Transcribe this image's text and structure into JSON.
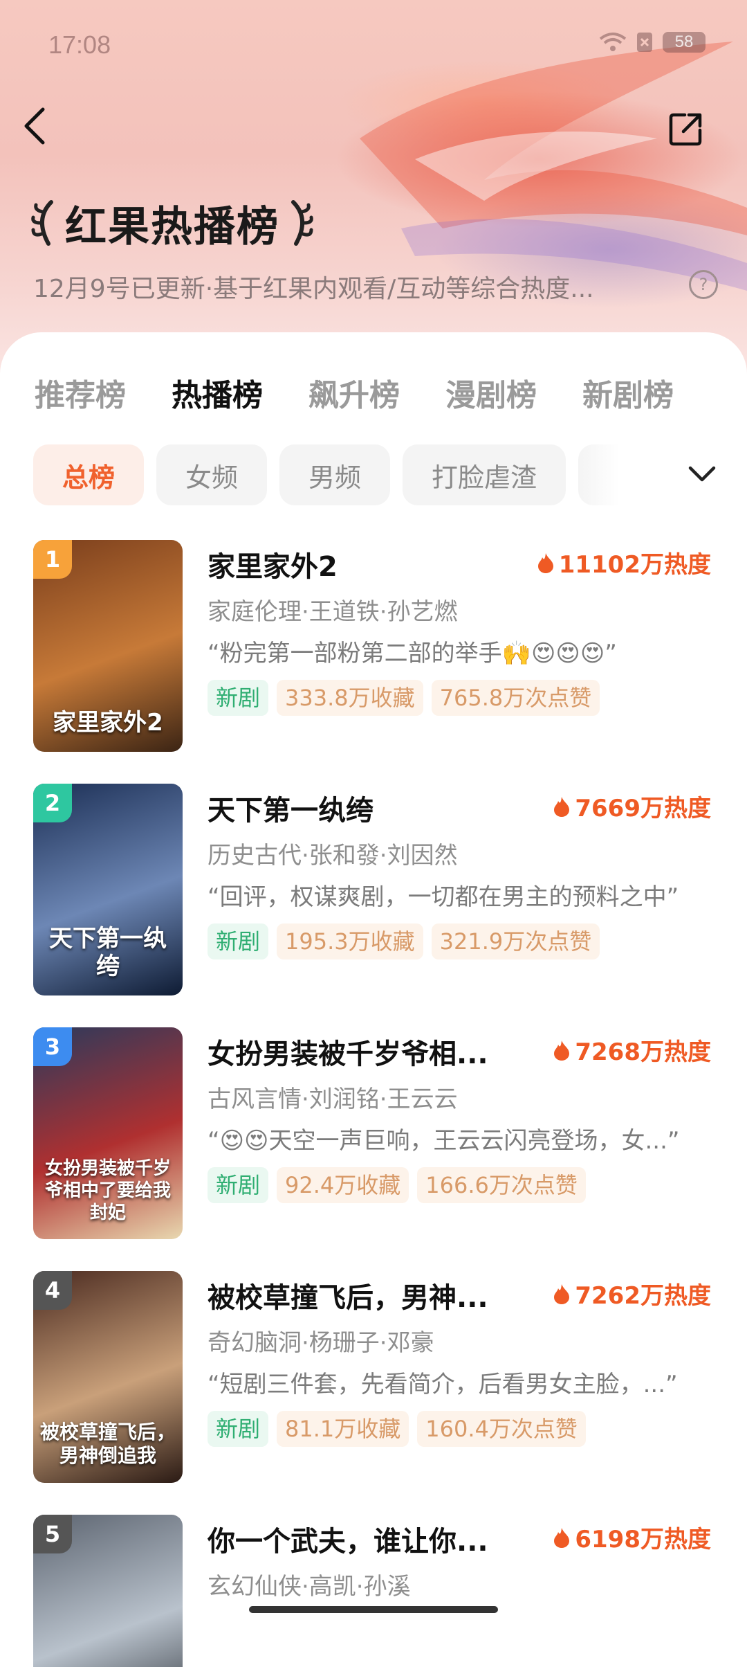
{
  "status": {
    "time": "17:08",
    "battery": "58"
  },
  "header": {
    "title": "红果热播榜",
    "subtitle": "12月9号已更新·基于红果内观看/互动等综合热度..."
  },
  "tabs": [
    {
      "label": "推荐榜",
      "active": false
    },
    {
      "label": "热播榜",
      "active": true
    },
    {
      "label": "飙升榜",
      "active": false
    },
    {
      "label": "漫剧榜",
      "active": false
    },
    {
      "label": "新剧榜",
      "active": false
    }
  ],
  "chips": [
    {
      "label": "总榜",
      "active": true
    },
    {
      "label": "女频",
      "active": false
    },
    {
      "label": "男频",
      "active": false
    },
    {
      "label": "打脸虐渣",
      "active": false
    }
  ],
  "items": [
    {
      "rank": "1",
      "rank_color": "#f7a23a",
      "title": "家里家外2",
      "heat": "11102万热度",
      "meta": "家庭伦理·王道铁·孙艺燃",
      "quote": "“粉完第一部粉第二部的举手🙌😍😍😍”",
      "poster_text": "家里家外2",
      "tags": [
        "新剧",
        "333.8万收藏",
        "765.8万次点赞"
      ],
      "poster_colors": [
        "#7a3e1c",
        "#c77a38",
        "#3b2414"
      ]
    },
    {
      "rank": "2",
      "rank_color": "#2ec7a0",
      "title": "天下第一纨绔",
      "heat": "7669万热度",
      "meta": "历史古代·张和發·刘因然",
      "quote": "“回评，权谋爽剧，一切都在男主的预料之中”",
      "poster_text": "天下第一纨绔",
      "tags": [
        "新剧",
        "195.3万收藏",
        "321.9万次点赞"
      ],
      "poster_colors": [
        "#1c2f55",
        "#6d87b5",
        "#0e1b33"
      ]
    },
    {
      "rank": "3",
      "rank_color": "#3d8cf0",
      "title": "女扮男装被千岁爷相...",
      "heat": "7268万热度",
      "meta": "古风言情·刘润铭·王云云",
      "quote": "“😍😍天空一声巨响，王云云闪亮登场，女...”",
      "poster_text": "女扮男装被千岁爷相中了要给我封妃",
      "tags": [
        "新剧",
        "92.4万收藏",
        "166.6万次点赞"
      ],
      "poster_colors": [
        "#2b3a5c",
        "#b03030",
        "#e8d8b0"
      ]
    },
    {
      "rank": "4",
      "rank_color": "#555555",
      "title": "被校草撞飞后，男神...",
      "heat": "7262万热度",
      "meta": "奇幻脑洞·杨珊子·邓豪",
      "quote": "“短剧三件套，先看简介，后看男女主脸，...”",
      "poster_text": "被校草撞飞后，男神倒追我",
      "tags": [
        "新剧",
        "81.1万收藏",
        "160.4万次点赞"
      ],
      "poster_colors": [
        "#4a2a20",
        "#c9a07a",
        "#2a1a14"
      ]
    },
    {
      "rank": "5",
      "rank_color": "#555555",
      "title": "你一个武夫，谁让你...",
      "heat": "6198万热度",
      "meta": "玄幻仙侠·高凯·孙溪",
      "quote": "",
      "poster_text": "",
      "tags": [],
      "poster_colors": [
        "#5c6470",
        "#b9c2cc",
        "#2a2f36"
      ]
    }
  ]
}
